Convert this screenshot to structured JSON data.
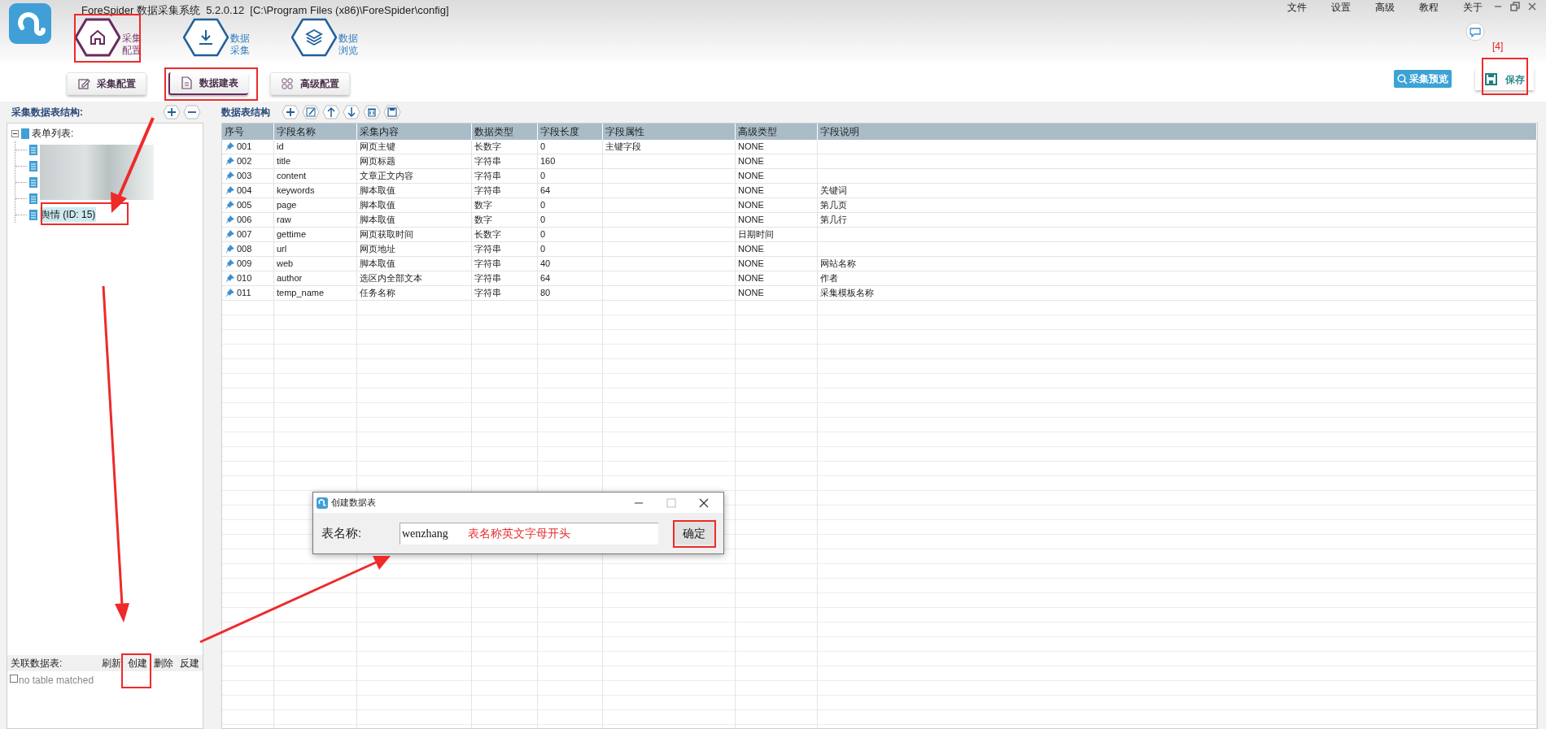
{
  "window": {
    "title": "ForeSpider 数据采集系统  5.2.0.12  [C:\\Program Files (x86)\\ForeSpider\\config]"
  },
  "menu": [
    "文件",
    "设置",
    "高级",
    "教程",
    "关于"
  ],
  "nav": [
    {
      "label": "采集配置",
      "kind": "home",
      "selected": true
    },
    {
      "label": "数据采集",
      "kind": "download",
      "selected": false
    },
    {
      "label": "数据浏览",
      "kind": "layers",
      "selected": false
    }
  ],
  "subtabs": [
    {
      "label": "采集配置",
      "kind": "edit",
      "selected": false
    },
    {
      "label": "数据建表",
      "kind": "doc",
      "selected": true
    },
    {
      "label": "高级配置",
      "kind": "grid",
      "selected": false
    }
  ],
  "preview_button": "采集预览",
  "save_button": "保存",
  "step_label": "[4]",
  "left_panel": {
    "title": "采集数据表结构:",
    "tree": {
      "label": "表单列表:",
      "expanded": true,
      "children": [
        {
          "kind": "redacted"
        },
        {
          "kind": "redacted"
        },
        {
          "kind": "redacted"
        },
        {
          "kind": "redacted"
        },
        {
          "kind": "item",
          "label": "舆情 (ID: 15)",
          "selected": true
        }
      ]
    }
  },
  "related": {
    "label": "关联数据表:",
    "actions": [
      "刷新",
      "创建",
      "删除",
      "反建"
    ],
    "empty": {
      "label": "no table matched",
      "checked": false
    }
  },
  "table_panel": {
    "title": "数据表结构",
    "tools": [
      {
        "kind": "add"
      },
      {
        "kind": "edit"
      },
      {
        "kind": "up"
      },
      {
        "kind": "down"
      },
      {
        "kind": "delete"
      },
      {
        "kind": "save"
      }
    ]
  },
  "table": {
    "columns": [
      "序号",
      "字段名称",
      "采集内容",
      "数据类型",
      "字段长度",
      "字段属性",
      "高级类型",
      "字段说明"
    ],
    "rows": [
      [
        "001",
        "id",
        "网页主键",
        "长数字",
        "0",
        "主键字段",
        "NONE",
        ""
      ],
      [
        "002",
        "title",
        "网页标题",
        "字符串",
        "160",
        "",
        "NONE",
        ""
      ],
      [
        "003",
        "content",
        "文章正文内容",
        "字符串",
        "0",
        "",
        "NONE",
        ""
      ],
      [
        "004",
        "keywords",
        "脚本取值",
        "字符串",
        "64",
        "",
        "NONE",
        "关键词"
      ],
      [
        "005",
        "page",
        "脚本取值",
        "数字",
        "0",
        "",
        "NONE",
        "第几页"
      ],
      [
        "006",
        "raw",
        "脚本取值",
        "数字",
        "0",
        "",
        "NONE",
        "第几行"
      ],
      [
        "007",
        "gettime",
        "网页获取时间",
        "长数字",
        "0",
        "",
        "日期时间",
        ""
      ],
      [
        "008",
        "url",
        "网页地址",
        "字符串",
        "0",
        "",
        "NONE",
        ""
      ],
      [
        "009",
        "web",
        "脚本取值",
        "字符串",
        "40",
        "",
        "NONE",
        "网站名称"
      ],
      [
        "010",
        "author",
        "选区内全部文本",
        "字符串",
        "64",
        "",
        "NONE",
        "作者"
      ],
      [
        "011",
        "temp_name",
        "任务名称",
        "字符串",
        "80",
        "",
        "NONE",
        "采集模板名称"
      ]
    ]
  },
  "dialog": {
    "title": "创建数据表",
    "label": "表名称:",
    "value": "wenzhang",
    "hint_annotation": "表名称英文字母开头",
    "ok_button": "确定"
  }
}
